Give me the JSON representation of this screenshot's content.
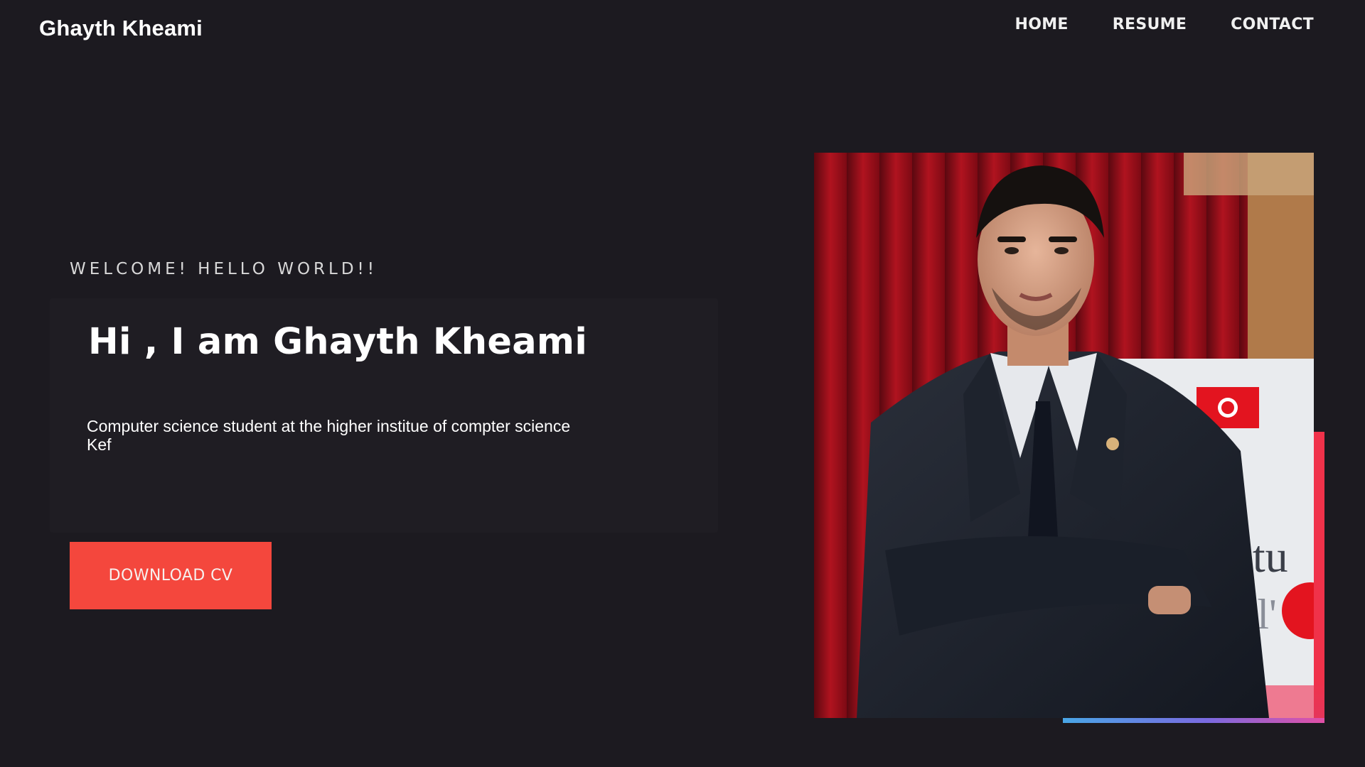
{
  "header": {
    "brand": "Ghayth Kheami",
    "nav": [
      {
        "label": "HOME"
      },
      {
        "label": "RESUME"
      },
      {
        "label": "CONTACT"
      }
    ]
  },
  "hero": {
    "eyebrow": "WELCOME! HELLO WORLD!!",
    "title": "Hi , I am Ghayth Kheami",
    "description": "Computer science student at the higher institue of compter science Kef",
    "cta_label": "DOWNLOAD CV"
  },
  "photo": {
    "subject": "portrait-photo",
    "banner_fragment_1": "actu",
    "banner_fragment_2": "itl'"
  },
  "colors": {
    "background": "#1c1a20",
    "accent": "#f4473d",
    "text": "#ffffff"
  }
}
